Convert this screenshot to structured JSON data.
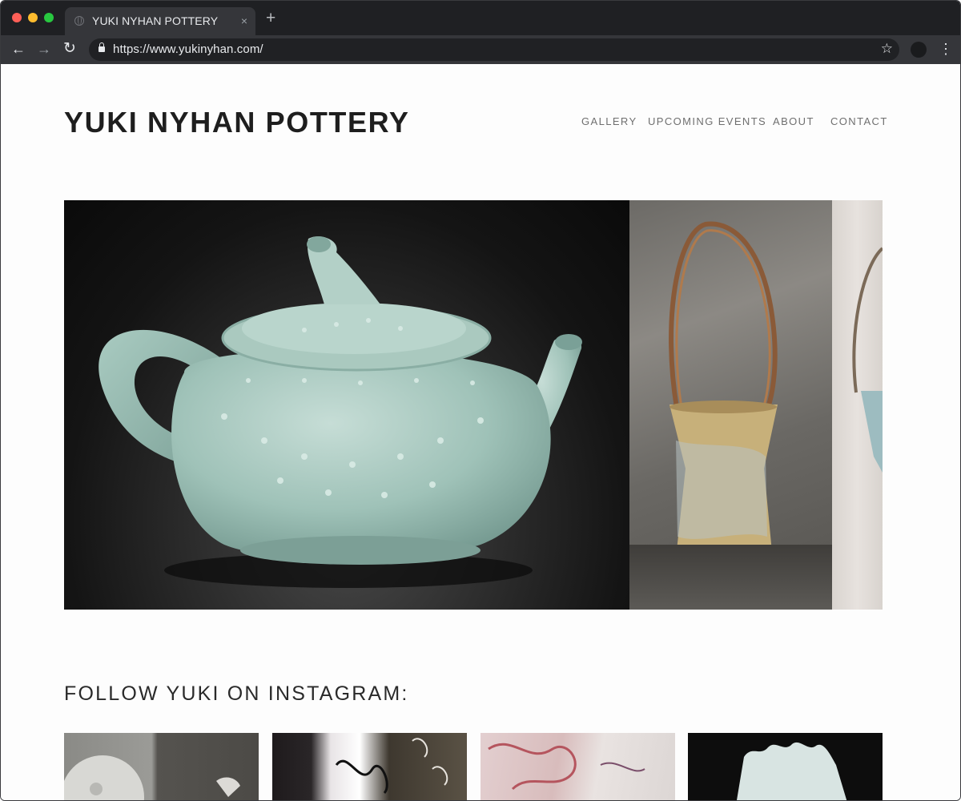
{
  "browser": {
    "tab_title": "YUKI NYHAN POTTERY",
    "tab_close": "×",
    "new_tab": "+",
    "url": "https://www.yukinyhan.com/",
    "back_icon": "←",
    "forward_icon": "→",
    "reload_icon": "↻",
    "star_icon": "☆",
    "menu_icon": "⋮"
  },
  "site": {
    "title": "YUKI NYHAN POTTERY",
    "nav": [
      "GALLERY",
      "UPCOMING EVENTS",
      "ABOUT",
      "CONTACT"
    ]
  },
  "hero": {
    "slides": [
      "celadon teapot",
      "wood-fired vase with woven handle",
      "partial celadon vase"
    ]
  },
  "instagram": {
    "heading": "FOLLOW YUKI ON INSTAGRAM:"
  }
}
